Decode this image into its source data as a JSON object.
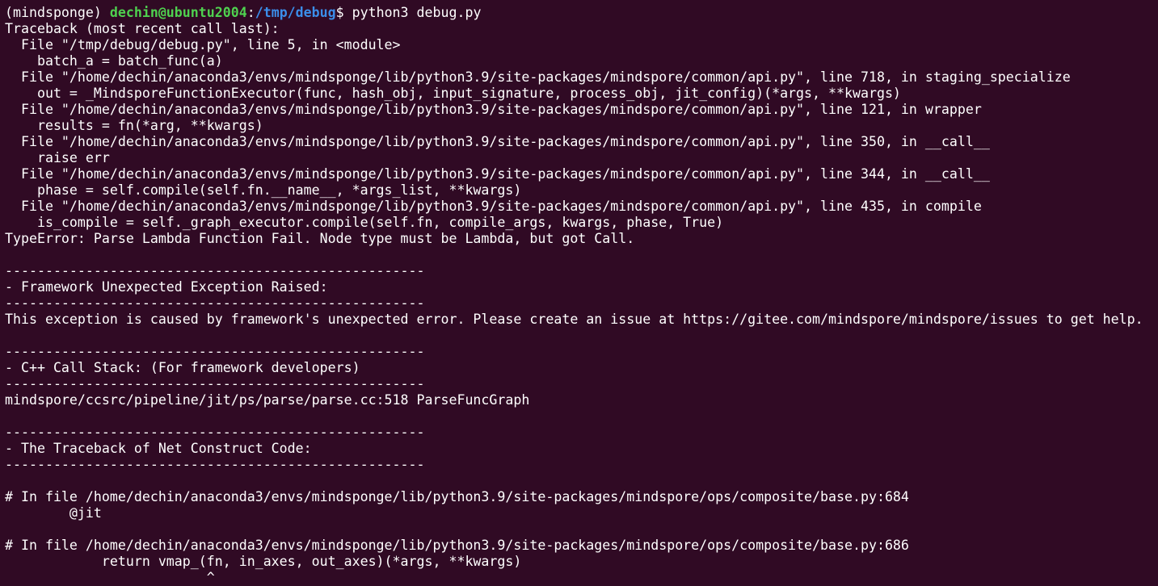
{
  "colors": {
    "background": "#300a24",
    "foreground": "#ffffff",
    "user_host": "#4fd14f",
    "path": "#3b8eea"
  },
  "prompt": {
    "env": "(mindsponge) ",
    "user_host": "dechin@ubuntu2004",
    "colon": ":",
    "path": "/tmp/debug",
    "symbol": "$ ",
    "command": "python3 debug.py"
  },
  "output": [
    "Traceback (most recent call last):",
    "  File \"/tmp/debug/debug.py\", line 5, in <module>",
    "    batch_a = batch_func(a)",
    "  File \"/home/dechin/anaconda3/envs/mindsponge/lib/python3.9/site-packages/mindspore/common/api.py\", line 718, in staging_specialize",
    "    out = _MindsporeFunctionExecutor(func, hash_obj, input_signature, process_obj, jit_config)(*args, **kwargs)",
    "  File \"/home/dechin/anaconda3/envs/mindsponge/lib/python3.9/site-packages/mindspore/common/api.py\", line 121, in wrapper",
    "    results = fn(*arg, **kwargs)",
    "  File \"/home/dechin/anaconda3/envs/mindsponge/lib/python3.9/site-packages/mindspore/common/api.py\", line 350, in __call__",
    "    raise err",
    "  File \"/home/dechin/anaconda3/envs/mindsponge/lib/python3.9/site-packages/mindspore/common/api.py\", line 344, in __call__",
    "    phase = self.compile(self.fn.__name__, *args_list, **kwargs)",
    "  File \"/home/dechin/anaconda3/envs/mindsponge/lib/python3.9/site-packages/mindspore/common/api.py\", line 435, in compile",
    "    is_compile = self._graph_executor.compile(self.fn, compile_args, kwargs, phase, True)",
    "TypeError: Parse Lambda Function Fail. Node type must be Lambda, but got Call.",
    "",
    "----------------------------------------------------",
    "- Framework Unexpected Exception Raised:",
    "----------------------------------------------------",
    "This exception is caused by framework's unexpected error. Please create an issue at https://gitee.com/mindspore/mindspore/issues to get help.",
    "",
    "----------------------------------------------------",
    "- C++ Call Stack: (For framework developers)",
    "----------------------------------------------------",
    "mindspore/ccsrc/pipeline/jit/ps/parse/parse.cc:518 ParseFuncGraph",
    "",
    "----------------------------------------------------",
    "- The Traceback of Net Construct Code:",
    "----------------------------------------------------",
    "",
    "# In file /home/dechin/anaconda3/envs/mindsponge/lib/python3.9/site-packages/mindspore/ops/composite/base.py:684",
    "        @jit",
    "",
    "# In file /home/dechin/anaconda3/envs/mindsponge/lib/python3.9/site-packages/mindspore/ops/composite/base.py:686",
    "            return vmap_(fn, in_axes, out_axes)(*args, **kwargs)",
    "                         ^"
  ]
}
